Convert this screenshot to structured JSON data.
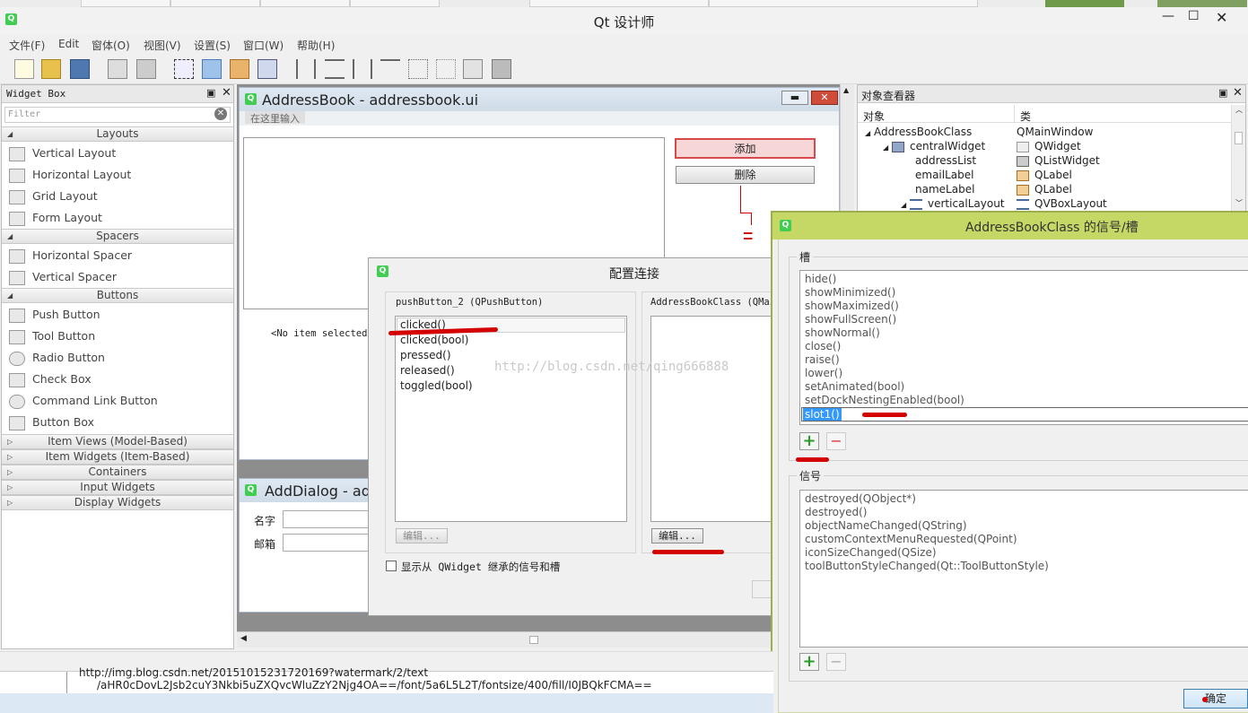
{
  "app": {
    "title": "Qt 设计师"
  },
  "menu": [
    "文件(F)",
    "Edit",
    "窗体(O)",
    "视图(V)",
    "设置(S)",
    "窗口(W)",
    "帮助(H)"
  ],
  "widget_box": {
    "title": "Widget Box",
    "filter_placeholder": "Filter",
    "categories": {
      "layouts": "Layouts",
      "spacers": "Spacers",
      "buttons": "Buttons"
    },
    "layouts": [
      "Vertical Layout",
      "Horizontal Layout",
      "Grid Layout",
      "Form Layout"
    ],
    "spacers": [
      "Horizontal Spacer",
      "Vertical Spacer"
    ],
    "buttons": [
      "Push Button",
      "Tool Button",
      "Radio Button",
      "Check Box",
      "Command Link Button",
      "Button Box"
    ],
    "collapsed": [
      "Item Views (Model-Based)",
      "Item Widgets (Item-Based)",
      "Containers",
      "Input Widgets",
      "Display Widgets"
    ]
  },
  "addressbook": {
    "title": "AddressBook - addressbook.ui",
    "type_here": "在这里输入",
    "add_button": "添加",
    "delete_button": "删除",
    "no_item": "<No item selected>"
  },
  "adddialog": {
    "title": "AddDialog - add",
    "name_label": "名字",
    "email_label": "邮箱"
  },
  "object_inspector": {
    "title": "对象查看器",
    "col_object": "对象",
    "col_class": "类",
    "rows": [
      {
        "name": "AddressBookClass",
        "cls": "QMainWindow"
      },
      {
        "name": "centralWidget",
        "cls": "QWidget"
      },
      {
        "name": "addressList",
        "cls": "QListWidget"
      },
      {
        "name": "emailLabel",
        "cls": "QLabel"
      },
      {
        "name": "nameLabel",
        "cls": "QLabel"
      },
      {
        "name": "verticalLayout",
        "cls": "QVBoxLayout"
      }
    ]
  },
  "config": {
    "title": "配置连接",
    "left_header": "pushButton_2 (QPushButton)",
    "right_header": "AddressBookClass (QMain",
    "signals": [
      "clicked()",
      "clicked(bool)",
      "pressed()",
      "released()",
      "toggled(bool)"
    ],
    "edit_left": "编辑...",
    "edit_right": "编辑...",
    "show_inherited": "显示从 QWidget 继承的信号和槽",
    "watermark": "http://blog.csdn.net/qing666888"
  },
  "slots_dialog": {
    "title": "AddressBookClass 的信号/槽",
    "slots_label": "槽",
    "slots": [
      "hide()",
      "showMinimized()",
      "showMaximized()",
      "showFullScreen()",
      "showNormal()",
      "close()",
      "raise()",
      "lower()",
      "setAnimated(bool)",
      "setDockNestingEnabled(bool)"
    ],
    "new_slot": "slot1()",
    "signals_label": "信号",
    "signals": [
      "destroyed(QObject*)",
      "destroyed()",
      "objectNameChanged(QString)",
      "customContextMenuRequested(QPoint)",
      "iconSizeChanged(QSize)",
      "toolButtonStyleChanged(Qt::ToolButtonStyle)"
    ],
    "ok_button": "确定"
  },
  "bottom_text": {
    "line1": "http://img.blog.csdn.net/20151015231720169?watermark/2/text",
    "line2": "/aHR0cDovL2Jsb2cuY3Nkbi5uZXQvcWluZzY2Njg4OA==/font/5a6L5L2T/fontsize/400/fill/I0JBQkFCMA=="
  },
  "colors": {
    "qt_green": "#41cd52",
    "slots_title_bg": "#c5d865",
    "highlight": "#3399ff",
    "annotation_red": "#d40000"
  }
}
